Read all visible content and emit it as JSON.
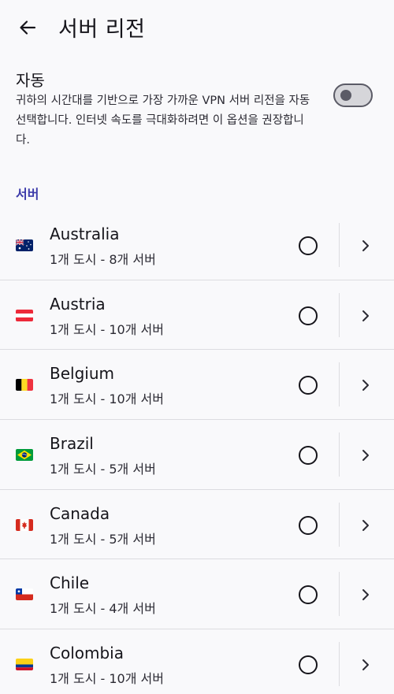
{
  "header": {
    "title": "서버 리전",
    "back_icon": "arrow-left-icon"
  },
  "auto": {
    "title": "자동",
    "description": "귀하의 시간대를 기반으로 가장 가까운 VPN 서버 리전을 자동 선택합니다. 인터넷 속도를 극대화하려면 이 옵션을 권장합니다.",
    "enabled": false
  },
  "servers": {
    "section_label": "서버",
    "items": [
      {
        "name": "Australia",
        "detail": "1개 도시 - 8개 서버",
        "flag": "au-flag-icon",
        "selected": false
      },
      {
        "name": "Austria",
        "detail": "1개 도시 - 10개 서버",
        "flag": "at-flag-icon",
        "selected": false
      },
      {
        "name": "Belgium",
        "detail": "1개 도시 - 10개 서버",
        "flag": "be-flag-icon",
        "selected": false
      },
      {
        "name": "Brazil",
        "detail": "1개 도시 - 5개 서버",
        "flag": "br-flag-icon",
        "selected": false
      },
      {
        "name": "Canada",
        "detail": "1개 도시 - 5개 서버",
        "flag": "ca-flag-icon",
        "selected": false
      },
      {
        "name": "Chile",
        "detail": "1개 도시 - 4개 서버",
        "flag": "cl-flag-icon",
        "selected": false
      },
      {
        "name": "Colombia",
        "detail": "1개 도시 - 10개 서버",
        "flag": "co-flag-icon",
        "selected": false
      }
    ]
  },
  "colors": {
    "accent": "#3d3bab",
    "text": "#15141a",
    "divider": "#dcdce0",
    "background": "#f9f9fb"
  }
}
